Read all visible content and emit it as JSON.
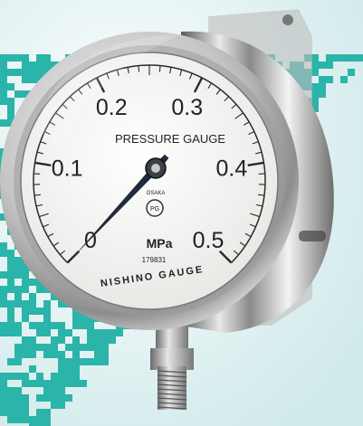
{
  "gauge": {
    "label": "PRESSURE GAUGE",
    "unit": "MPa",
    "city": "OSAKA",
    "serial": "179831",
    "brand": "NISHINO GAUGE",
    "logo_text": "PG",
    "reading": 0.0,
    "scale": {
      "min": 0,
      "max": 0.5,
      "major_labels": [
        "0",
        "0.1",
        "0.2",
        "0.3",
        "0.4",
        "0.5"
      ]
    }
  },
  "colors": {
    "background": "#dbeeef",
    "pattern": "#2bb4a9",
    "dial_face": "#f4f4f2",
    "needle": "#1f2a3a",
    "bezel_steel": "#c9c9c9"
  },
  "icons": {
    "maker_logo": "pg-logo-icon"
  }
}
